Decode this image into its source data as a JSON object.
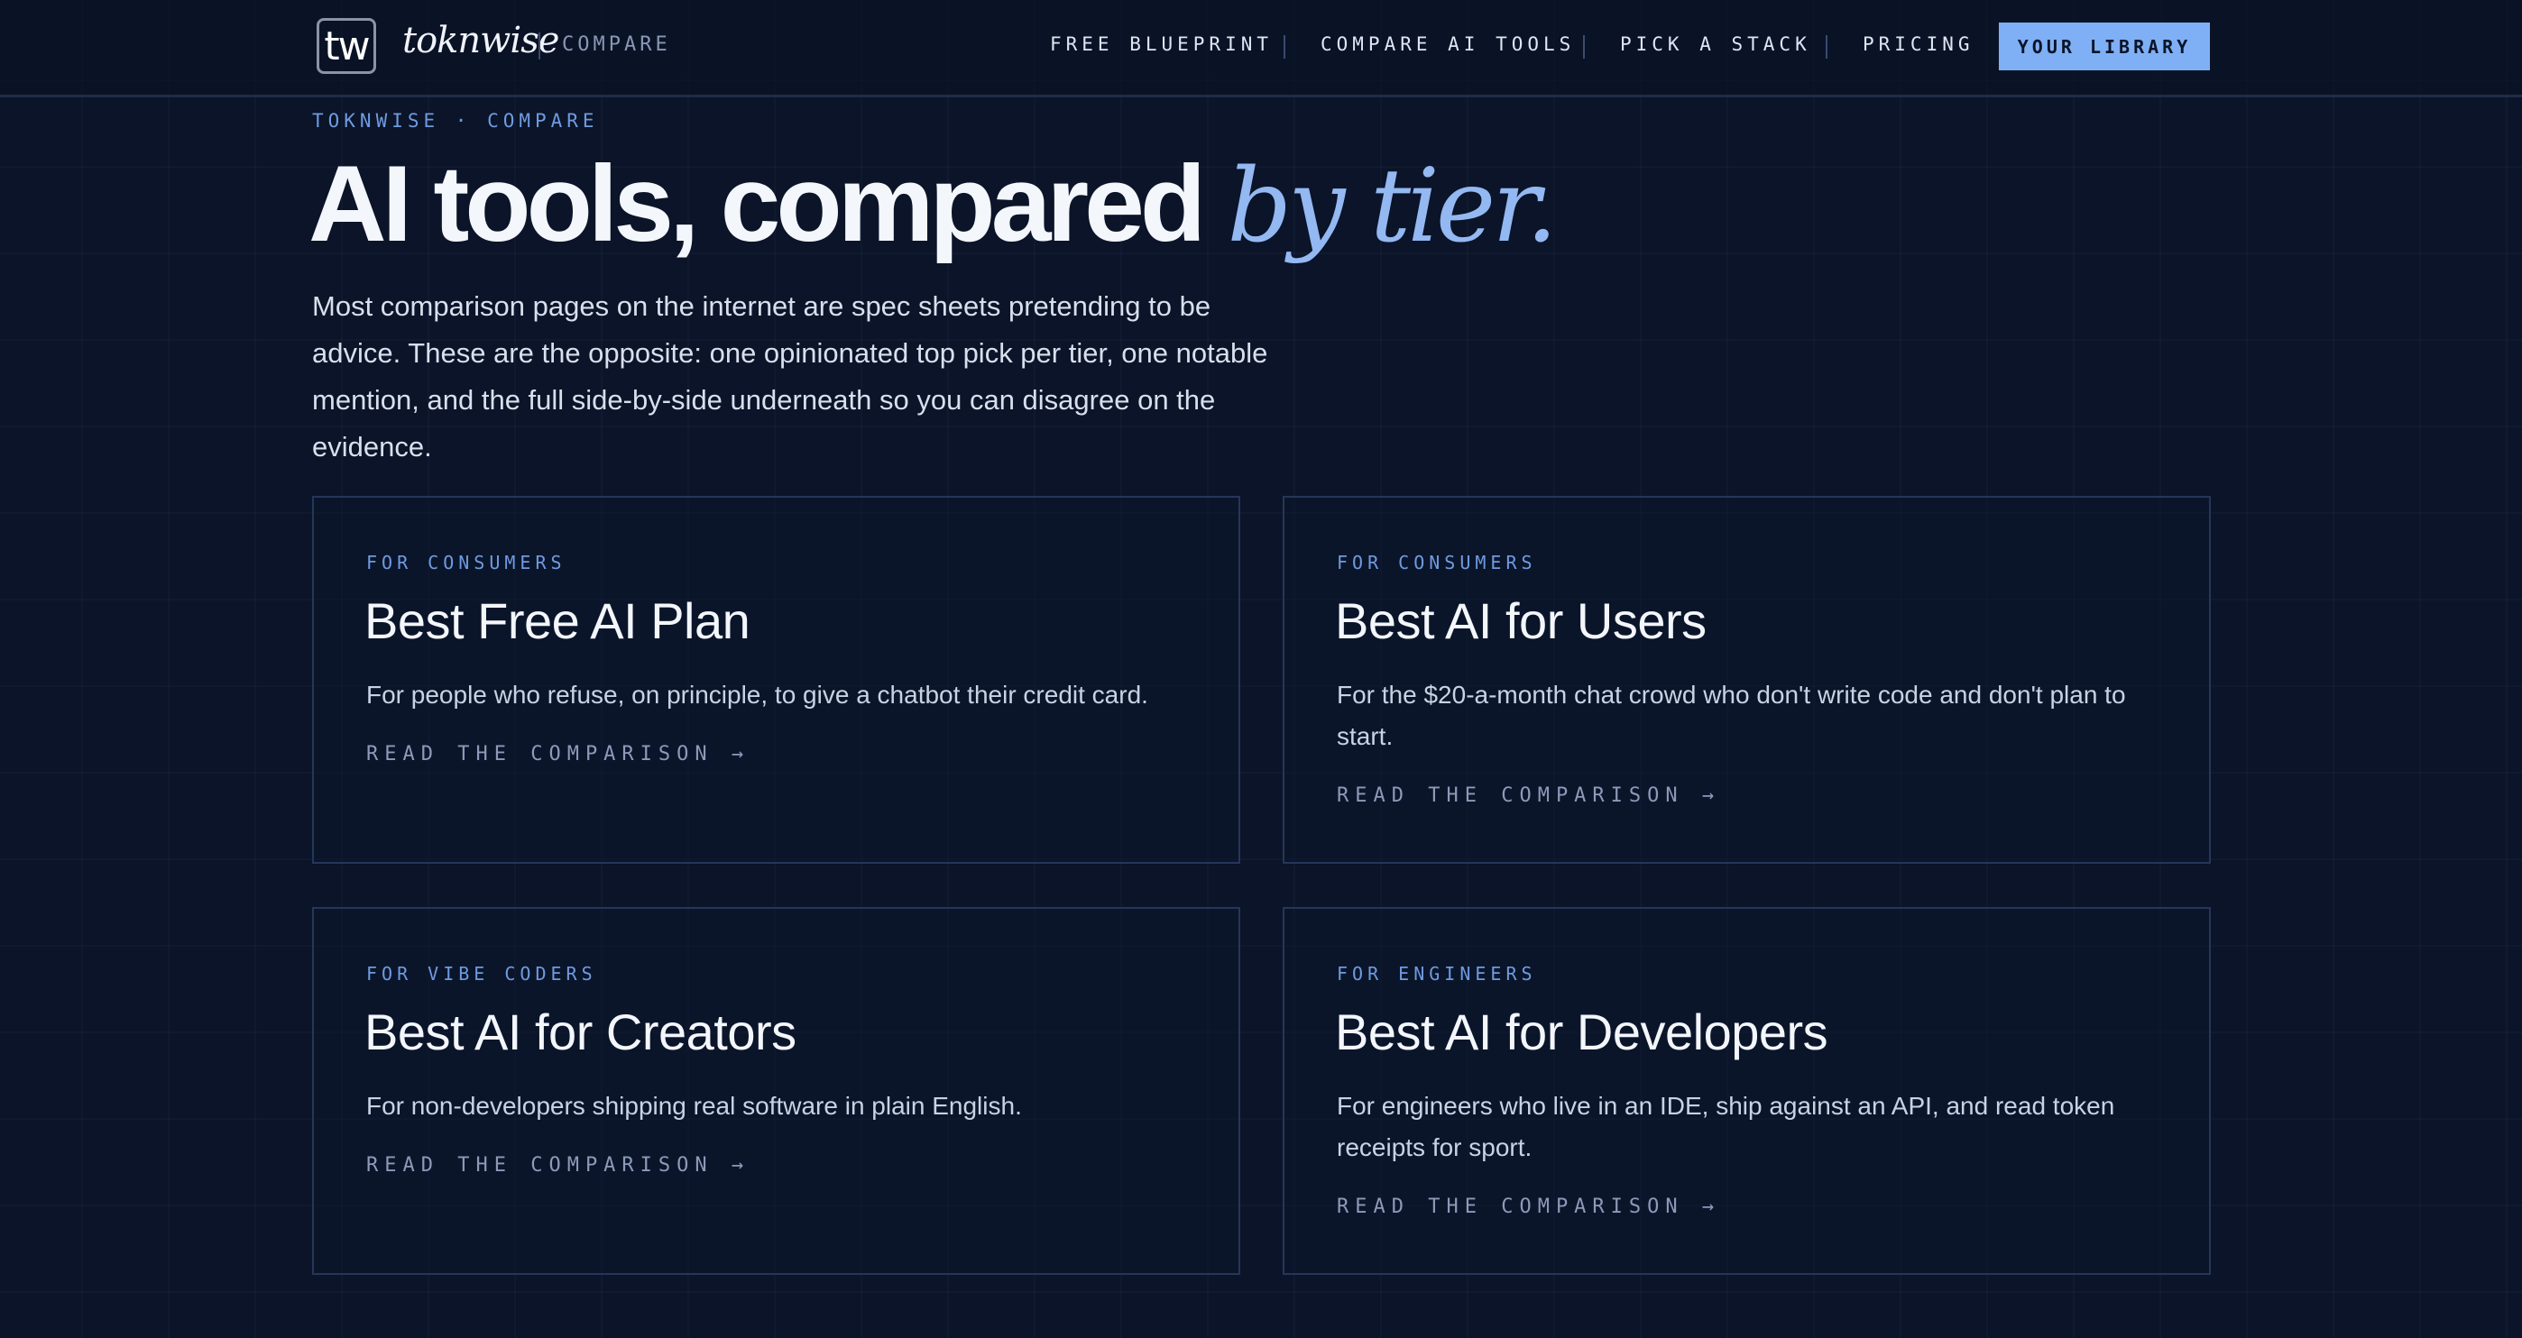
{
  "header": {
    "logo_mark": "tw",
    "brand_name": "toknwise",
    "section": "COMPARE",
    "nav": [
      "FREE BLUEPRINT",
      "COMPARE AI TOOLS",
      "PICK A STACK",
      "PRICING"
    ],
    "library_button": "YOUR LIBRARY"
  },
  "hero": {
    "eyebrow": "TOKNWISE · COMPARE",
    "title_main": "AI tools, compared",
    "title_accent": "by tier.",
    "intro": "Most comparison pages on the internet are spec sheets pretending to be advice. These are the opposite: one opinionated top pick per tier, one notable mention, and the full side-by-side underneath so you can disagree on the evidence."
  },
  "cards": [
    {
      "tag": "FOR CONSUMERS",
      "title": "Best Free AI Plan",
      "description": "For people who refuse, on principle, to give a chatbot their credit card.",
      "link": "READ THE COMPARISON →"
    },
    {
      "tag": "FOR CONSUMERS",
      "title": "Best AI for Users",
      "description": "For the $20-a-month chat crowd who don't write code and don't plan to start.",
      "link": "READ THE COMPARISON →"
    },
    {
      "tag": "FOR VIBE CODERS",
      "title": "Best AI for Creators",
      "description": "For non-developers shipping real software in plain English.",
      "link": "READ THE COMPARISON →"
    },
    {
      "tag": "FOR ENGINEERS",
      "title": "Best AI for Developers",
      "description": "For engineers who live in an IDE, ship against an API, and read token receipts for sport.",
      "link": "READ THE COMPARISON →"
    }
  ],
  "colors": {
    "background": "#0b1428",
    "accent": "#7fb0f6",
    "eyebrow": "#6f9be0",
    "card_border": "#26365a"
  }
}
